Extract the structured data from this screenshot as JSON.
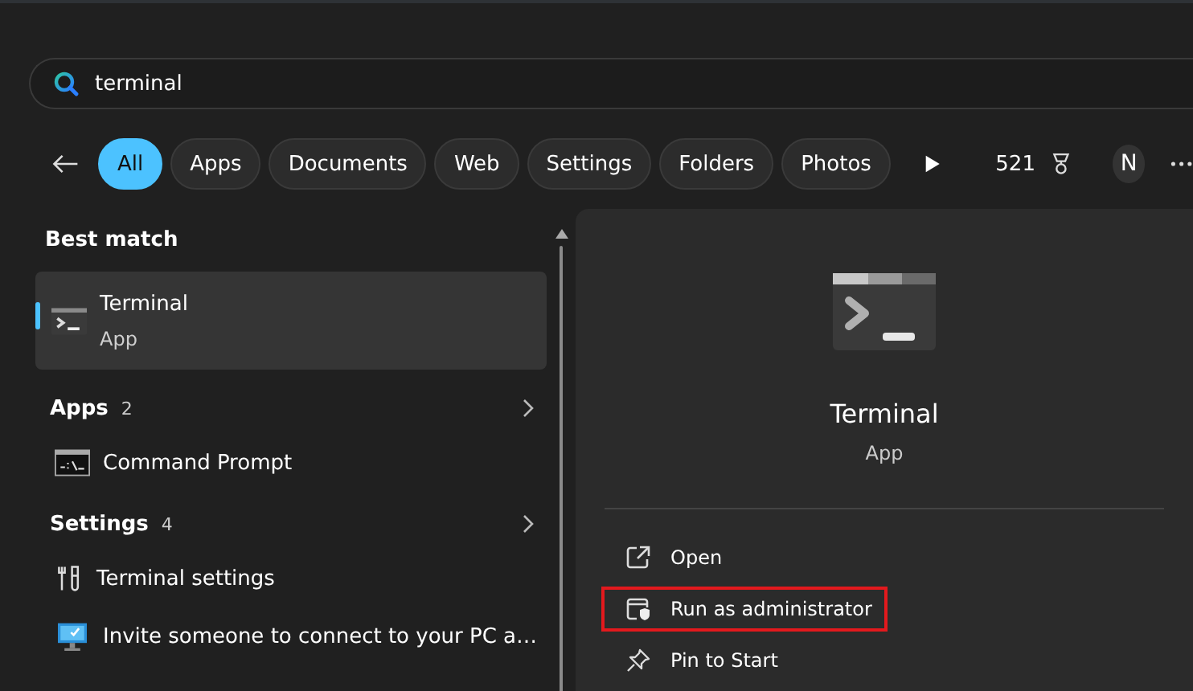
{
  "search": {
    "value": "terminal"
  },
  "filters": [
    {
      "label": "All",
      "selected": true
    },
    {
      "label": "Apps",
      "selected": false
    },
    {
      "label": "Documents",
      "selected": false
    },
    {
      "label": "Web",
      "selected": false
    },
    {
      "label": "Settings",
      "selected": false
    },
    {
      "label": "Folders",
      "selected": false
    },
    {
      "label": "Photos",
      "selected": false
    }
  ],
  "points": "521",
  "avatar": "N",
  "best_match": {
    "heading": "Best match",
    "item": {
      "title": "Terminal",
      "subtitle": "App",
      "selected": true
    }
  },
  "groups": [
    {
      "heading": "Apps",
      "count": "2",
      "items": [
        {
          "title": "Command Prompt",
          "kind": "cmd"
        }
      ]
    },
    {
      "heading": "Settings",
      "count": "4",
      "items": [
        {
          "title": "Terminal settings",
          "kind": "settings"
        },
        {
          "title": "Invite someone to connect to your PC a…",
          "kind": "remote"
        }
      ]
    }
  ],
  "detail": {
    "title": "Terminal",
    "subtitle": "App",
    "actions": [
      {
        "label": "Open",
        "kind": "open",
        "highlighted": false
      },
      {
        "label": "Run as administrator",
        "kind": "admin",
        "highlighted": true
      },
      {
        "label": "Pin to Start",
        "kind": "pin",
        "highlighted": false
      }
    ]
  }
}
